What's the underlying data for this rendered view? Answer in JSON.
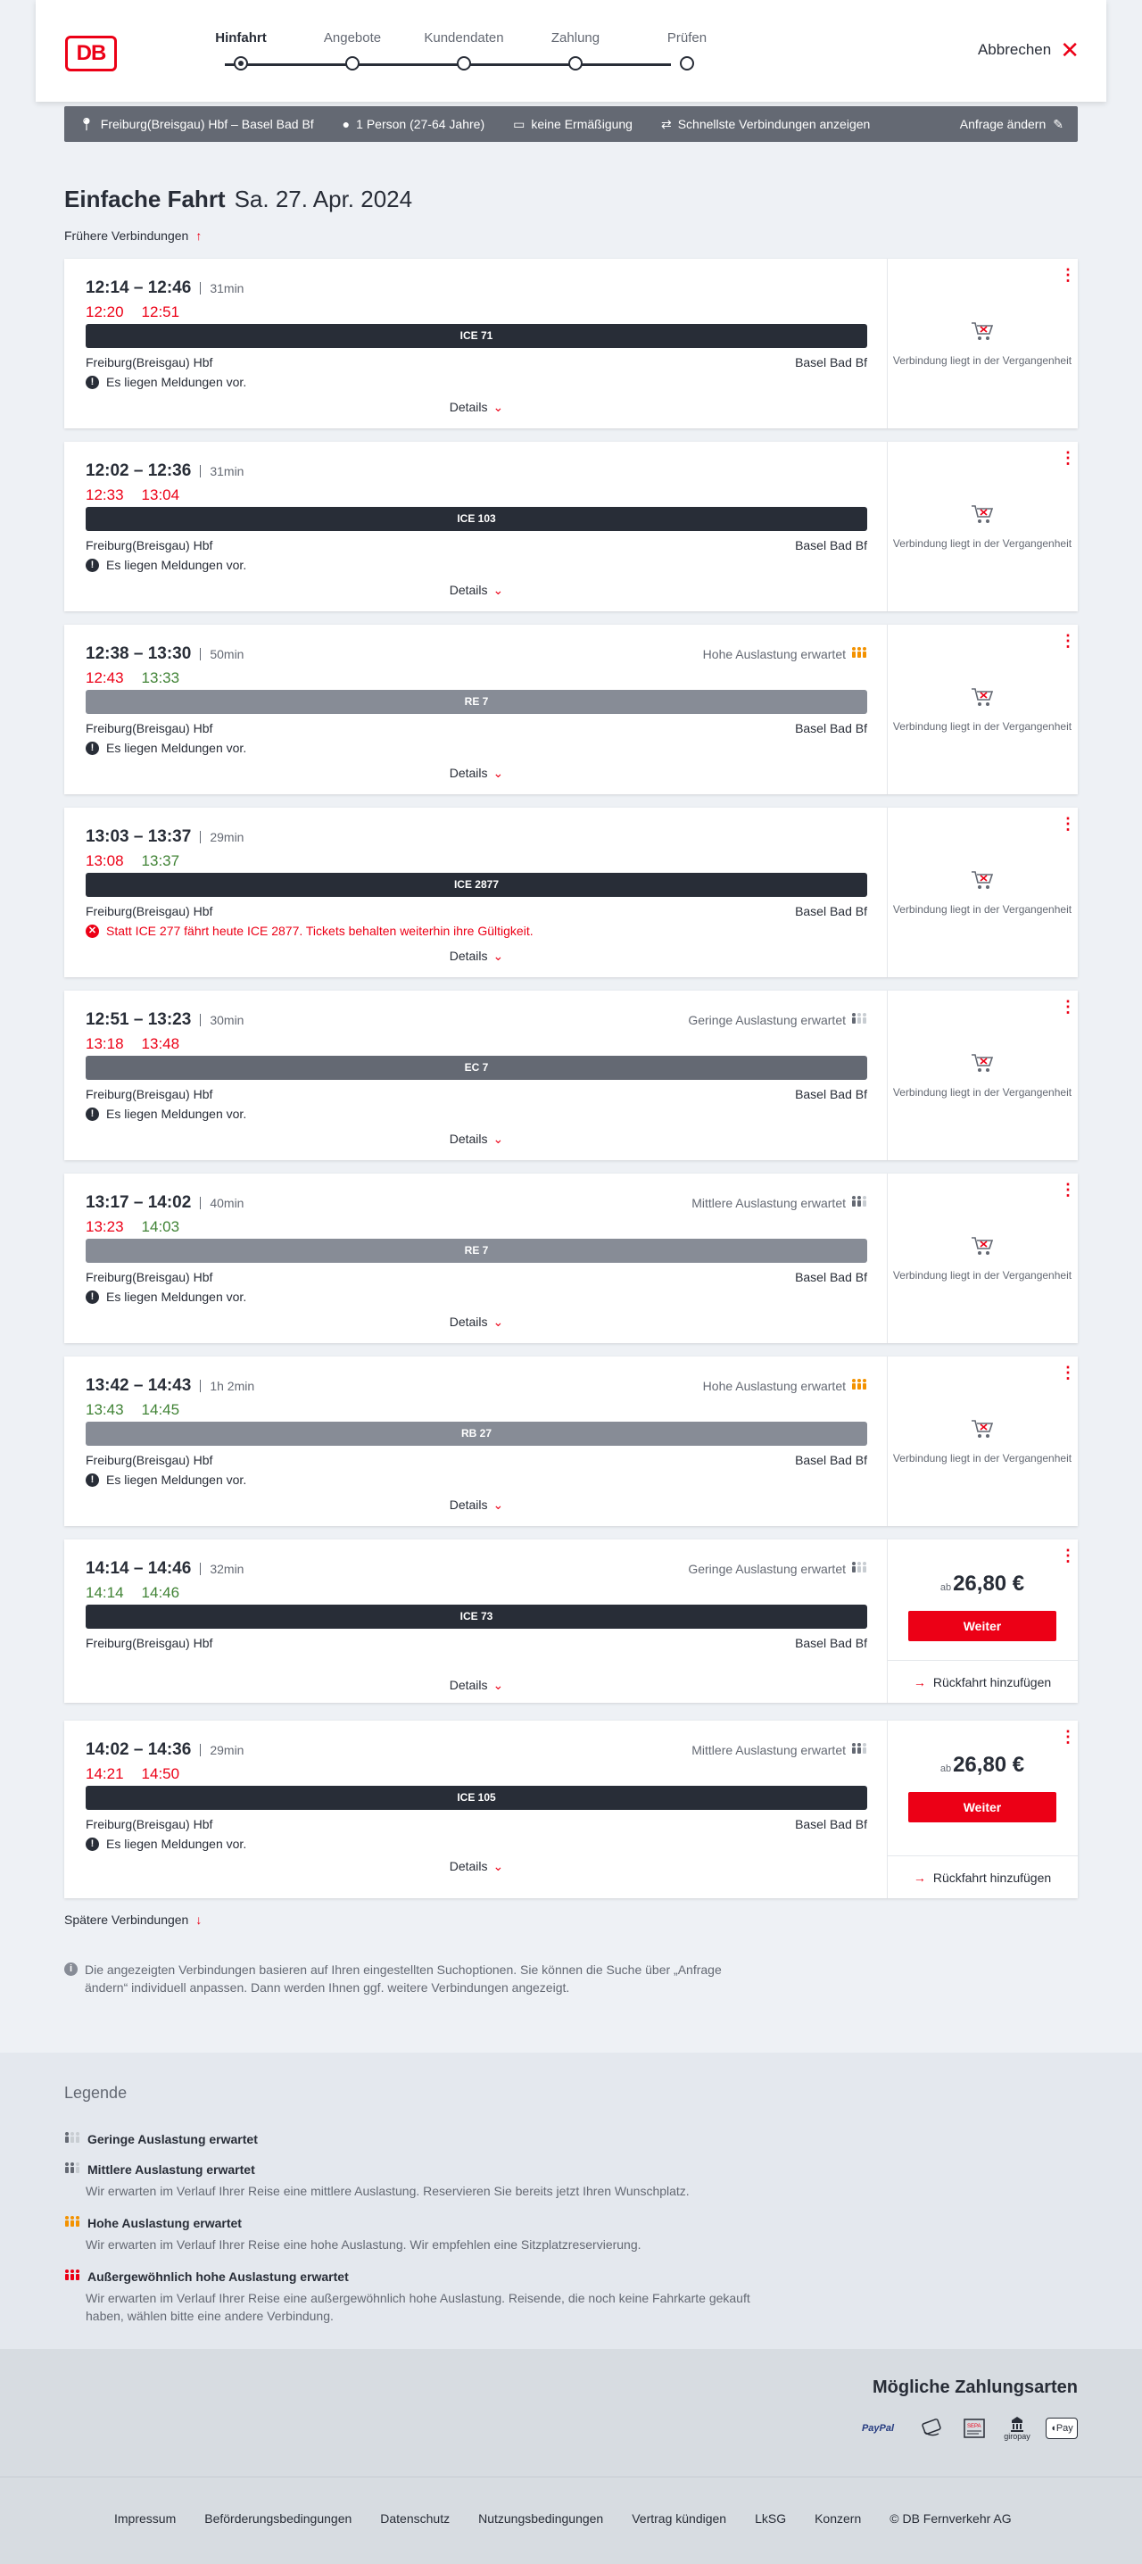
{
  "logo": "DB",
  "steps": [
    "Hinfahrt",
    "Angebote",
    "Kundendaten",
    "Zahlung",
    "Prüfen"
  ],
  "cancel": "Abbrechen",
  "search": {
    "route": "Freiburg(Breisgau) Hbf – Basel Bad Bf",
    "persons": "1 Person (27-64 Jahre)",
    "discount": "keine Ermäßigung",
    "option": "Schnellste Verbindungen anzeigen",
    "edit": "Anfrage ändern"
  },
  "title": {
    "trip": "Einfache Fahrt",
    "date": "Sa. 27. Apr. 2024"
  },
  "earlier": "Frühere Verbindungen",
  "later": "Spätere Verbindungen",
  "connections": [
    {
      "time": "12:14 – 12:46",
      "duration": "31min",
      "rt_dep": "12:20",
      "rt_arr": "12:51",
      "rt_dep_color": "late",
      "rt_arr_color": "late",
      "train": "ICE 71",
      "train_color": "#282d37",
      "from": "Freiburg(Breisgau) Hbf",
      "to": "Basel Bad Bf",
      "msg": "Es liegen Meldungen vor.",
      "msg_type": "info",
      "load": "",
      "status": "Verbindung liegt in der Vergangenheit"
    },
    {
      "time": "12:02 – 12:36",
      "duration": "31min",
      "rt_dep": "12:33",
      "rt_arr": "13:04",
      "rt_dep_color": "late",
      "rt_arr_color": "late",
      "train": "ICE 103",
      "train_color": "#282d37",
      "from": "Freiburg(Breisgau) Hbf",
      "to": "Basel Bad Bf",
      "msg": "Es liegen Meldungen vor.",
      "msg_type": "info",
      "load": "",
      "status": "Verbindung liegt in der Vergangenheit"
    },
    {
      "time": "12:38 – 13:30",
      "duration": "50min",
      "rt_dep": "12:43",
      "rt_arr": "13:33",
      "rt_dep_color": "late",
      "rt_arr_color": "ok",
      "train": "RE 7",
      "train_color": "#878c96",
      "from": "Freiburg(Breisgau) Hbf",
      "to": "Basel Bad Bf",
      "msg": "Es liegen Meldungen vor.",
      "msg_type": "info",
      "load": "Hohe Auslastung erwartet",
      "load_level": "high",
      "status": "Verbindung liegt in der Vergangenheit"
    },
    {
      "time": "13:03 – 13:37",
      "duration": "29min",
      "rt_dep": "13:08",
      "rt_arr": "13:37",
      "rt_dep_color": "late",
      "rt_arr_color": "ok",
      "train": "ICE 2877",
      "train_color": "#282d37",
      "from": "Freiburg(Breisgau) Hbf",
      "to": "Basel Bad Bf",
      "msg": "Statt ICE 277 fährt heute ICE 2877. Tickets behalten weiterhin ihre Gültigkeit.",
      "msg_type": "err",
      "load": "",
      "status": "Verbindung liegt in der Vergangenheit"
    },
    {
      "time": "12:51 – 13:23",
      "duration": "30min",
      "rt_dep": "13:18",
      "rt_arr": "13:48",
      "rt_dep_color": "late",
      "rt_arr_color": "late",
      "train": "EC 7",
      "train_color": "#646973",
      "from": "Freiburg(Breisgau) Hbf",
      "to": "Basel Bad Bf",
      "msg": "Es liegen Meldungen vor.",
      "msg_type": "info",
      "load": "Geringe Auslastung erwartet",
      "load_level": "low",
      "status": "Verbindung liegt in der Vergangenheit"
    },
    {
      "time": "13:17 – 14:02",
      "duration": "40min",
      "rt_dep": "13:23",
      "rt_arr": "14:03",
      "rt_dep_color": "late",
      "rt_arr_color": "ok",
      "train": "RE 7",
      "train_color": "#878c96",
      "from": "Freiburg(Breisgau) Hbf",
      "to": "Basel Bad Bf",
      "msg": "Es liegen Meldungen vor.",
      "msg_type": "info",
      "load": "Mittlere Auslastung erwartet",
      "load_level": "mid",
      "status": "Verbindung liegt in der Vergangenheit"
    },
    {
      "time": "13:42 – 14:43",
      "duration": "1h 2min",
      "rt_dep": "13:43",
      "rt_arr": "14:45",
      "rt_dep_color": "ok",
      "rt_arr_color": "ok",
      "train": "RB 27",
      "train_color": "#878c96",
      "from": "Freiburg(Breisgau) Hbf",
      "to": "Basel Bad Bf",
      "msg": "Es liegen Meldungen vor.",
      "msg_type": "info",
      "load": "Hohe Auslastung erwartet",
      "load_level": "high",
      "status": "Verbindung liegt in der Vergangenheit"
    },
    {
      "time": "14:14 – 14:46",
      "duration": "32min",
      "rt_dep": "14:14",
      "rt_arr": "14:46",
      "rt_dep_color": "ok",
      "rt_arr_color": "ok",
      "train": "ICE 73",
      "train_color": "#282d37",
      "from": "Freiburg(Breisgau) Hbf",
      "to": "Basel Bad Bf",
      "msg": "",
      "msg_type": "",
      "load": "Geringe Auslastung erwartet",
      "load_level": "low",
      "price_prefix": "ab",
      "price": "26,80 €",
      "button": "Weiter",
      "return": "Rückfahrt hinzufügen"
    },
    {
      "time": "14:02 – 14:36",
      "duration": "29min",
      "rt_dep": "14:21",
      "rt_arr": "14:50",
      "rt_dep_color": "late",
      "rt_arr_color": "late",
      "train": "ICE 105",
      "train_color": "#282d37",
      "from": "Freiburg(Breisgau) Hbf",
      "to": "Basel Bad Bf",
      "msg": "Es liegen Meldungen vor.",
      "msg_type": "info",
      "load": "Mittlere Auslastung erwartet",
      "load_level": "mid",
      "price_prefix": "ab",
      "price": "26,80 €",
      "button": "Weiter",
      "return": "Rückfahrt hinzufügen"
    }
  ],
  "details_label": "Details",
  "note": "Die angezeigten Verbindungen basieren auf Ihren eingestellten Suchoptionen. Sie können die Suche über „Anfrage ändern“ individuell anpassen. Dann werden Ihnen ggf. weitere Verbindungen angezeigt.",
  "legend": {
    "title": "Legende",
    "items": [
      {
        "title": "Geringe Auslastung erwartet",
        "desc": "",
        "level": "low"
      },
      {
        "title": "Mittlere Auslastung erwartet",
        "desc": "Wir erwarten im Verlauf Ihrer Reise eine mittlere Auslastung. Reservieren Sie bereits jetzt Ihren Wunschplatz.",
        "level": "mid"
      },
      {
        "title": "Hohe Auslastung erwartet",
        "desc": "Wir erwarten im Verlauf Ihrer Reise eine hohe Auslastung. Wir empfehlen eine Sitzplatzreservierung.",
        "level": "high"
      },
      {
        "title": "Außergewöhnlich hohe Auslastung erwartet",
        "desc": "Wir erwarten im Verlauf Ihrer Reise eine außergewöhnlich hohe Auslastung. Reisende, die noch keine Fahrkarte gekauft haben, wählen bitte eine andere Verbindung.",
        "level": "extreme"
      }
    ]
  },
  "payment": {
    "title": "Mögliche Zahlungsarten",
    "methods": [
      "PayPal",
      "Kreditkarte",
      "SEPA",
      "giropay",
      "Pay"
    ]
  },
  "footer": [
    "Impressum",
    "Beförderungsbedingungen",
    "Datenschutz",
    "Nutzungsbedingungen",
    "Vertrag kündigen",
    "LkSG",
    "Konzern",
    "© DB Fernverkehr AG"
  ],
  "colors": {
    "accent": "#ec0016",
    "late": "#ec0016",
    "ok": "#408335",
    "high_load": "#f39200"
  }
}
